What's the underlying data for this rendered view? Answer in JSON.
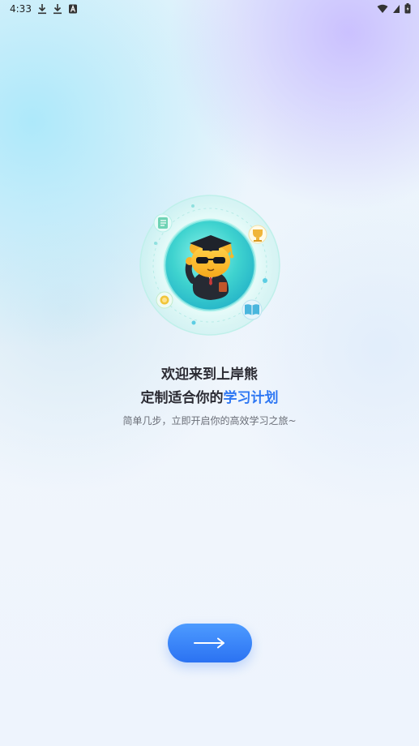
{
  "status_bar": {
    "time": "4:33",
    "left_icons": [
      "download-icon",
      "download-icon",
      "notification-a-icon"
    ],
    "right_icons": [
      "wifi-icon",
      "signal-icon",
      "battery-icon"
    ]
  },
  "hero": {
    "icons": [
      "mascot-bear-graduate-icon",
      "notebook-icon",
      "trophy-icon",
      "book-icon",
      "coin-icon"
    ]
  },
  "welcome": {
    "line1": "欢迎来到上岸熊",
    "line2_prefix": "定制适合你的",
    "line2_highlight": "学习计划",
    "subtitle": "简单几步，立即开启你的高效学习之旅~"
  },
  "colors": {
    "accent": "#2e77f3",
    "title": "#2b2b33",
    "subtitle": "#6b6f78"
  },
  "next_button": {
    "icon": "arrow-right-icon"
  }
}
